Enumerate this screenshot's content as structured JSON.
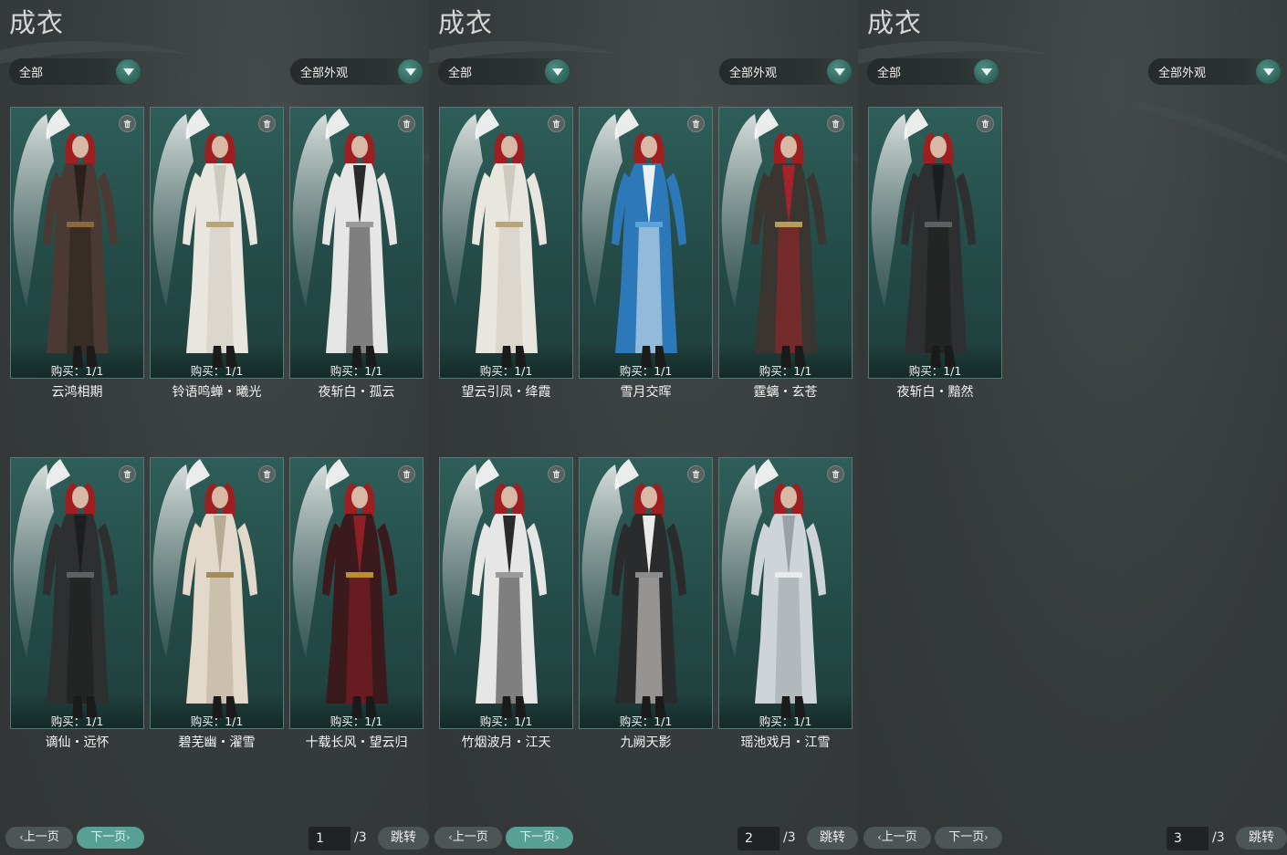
{
  "panels": [
    {
      "title": "成衣",
      "filter_category": "全部",
      "filter_appearance": "全部外观",
      "items": [
        {
          "buy": "购买：1/1",
          "name": "云鸿相期",
          "palette": "brown"
        },
        {
          "buy": "购买：1/1",
          "name": "铃语鸣蝉・曦光",
          "palette": "white"
        },
        {
          "buy": "购买：1/1",
          "name": "夜斩白・孤云",
          "palette": "whiteblack"
        },
        {
          "buy": "购买：1/1",
          "name": "谪仙・远怀",
          "palette": "black"
        },
        {
          "buy": "购买：1/1",
          "name": "碧芜幽・濯雪",
          "palette": "cream"
        },
        {
          "buy": "购买：1/1",
          "name": "十载长风・望云归",
          "palette": "crimson"
        }
      ],
      "pagination": {
        "prev": "上一页",
        "next": "下一页",
        "page": "1",
        "total": "/3",
        "jump": "跳转"
      }
    },
    {
      "title": "成衣",
      "filter_category": "全部",
      "filter_appearance": "全部外观",
      "items": [
        {
          "buy": "购买：1/1",
          "name": "望云引凤・绛霞",
          "palette": "white"
        },
        {
          "buy": "购买：1/1",
          "name": "雪月交晖",
          "palette": "blue"
        },
        {
          "buy": "购买：1/1",
          "name": "霆螭・玄苍",
          "palette": "redblack"
        },
        {
          "buy": "购买：1/1",
          "name": "竹烟波月・江天",
          "palette": "whiteblack"
        },
        {
          "buy": "购买：1/1",
          "name": "九阙天影",
          "palette": "blackwhite"
        },
        {
          "buy": "购买：1/1",
          "name": "瑶池戏月・江雪",
          "palette": "silver"
        }
      ],
      "pagination": {
        "prev": "上一页",
        "next": "下一页",
        "page": "2",
        "total": "/3",
        "jump": "跳转"
      }
    },
    {
      "title": "成衣",
      "filter_category": "全部",
      "filter_appearance": "全部外观",
      "items": [
        {
          "buy": "购买：1/1",
          "name": "夜斩白・黯然",
          "palette": "black"
        }
      ],
      "pagination": {
        "prev": "上一页",
        "next": "下一页",
        "page": "3",
        "total": "/3",
        "jump": "跳转"
      }
    }
  ],
  "palettes": {
    "brown": {
      "robe": "#4a3a33",
      "inner": "#2a211d",
      "accent": "#8a6a3a"
    },
    "white": {
      "robe": "#e9e6df",
      "inner": "#cfcac0",
      "accent": "#b9a57a"
    },
    "whiteblack": {
      "robe": "#e6e6e6",
      "inner": "#2a2a2a",
      "accent": "#9a9a9a"
    },
    "black": {
      "robe": "#2e2f30",
      "inner": "#1c1d1e",
      "accent": "#5e6162"
    },
    "cream": {
      "robe": "#e3d9ca",
      "inner": "#b8ab96",
      "accent": "#a58a5a"
    },
    "crimson": {
      "robe": "#3a1a1c",
      "inner": "#8e1f26",
      "accent": "#b8902e"
    },
    "blue": {
      "robe": "#2d78b8",
      "inner": "#eaf0f4",
      "accent": "#5aa3d8"
    },
    "redblack": {
      "robe": "#3a3530",
      "inner": "#a3232a",
      "accent": "#b89a5a"
    },
    "blackwhite": {
      "robe": "#2a2b2c",
      "inner": "#ecebea",
      "accent": "#8c8c8c"
    },
    "silver": {
      "robe": "#cfd4d8",
      "inner": "#9aa2a8",
      "accent": "#e9ecee"
    }
  }
}
